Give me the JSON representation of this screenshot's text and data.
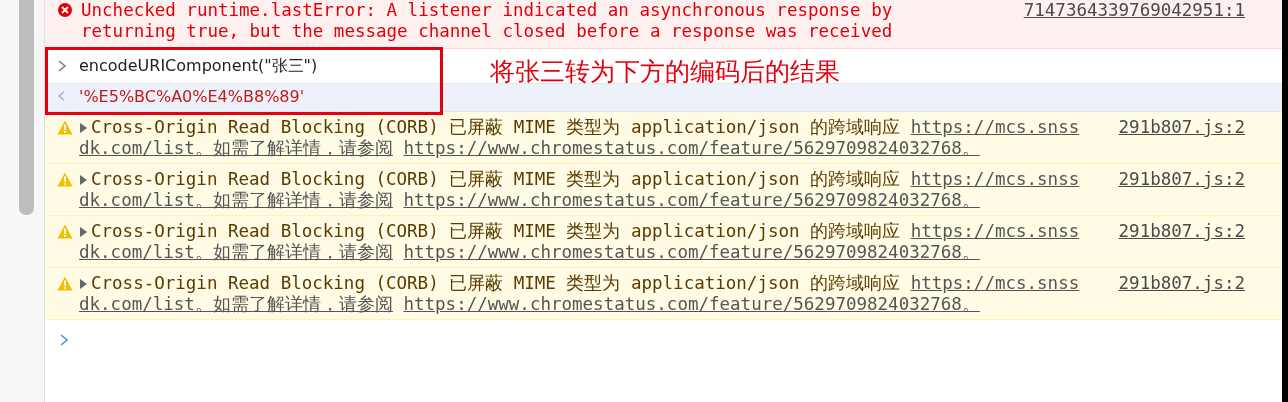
{
  "error": {
    "text_1": "Unchecked runtime.lastError: A listener indicated an asynchronous response by",
    "text_2": "returning true, but the message channel closed before a response was received",
    "source": "7147364339769042951:1"
  },
  "input": {
    "code": "encodeURIComponent(\"张三\")"
  },
  "output": {
    "value": "'%E5%BC%A0%E4%B8%89'"
  },
  "annotation": {
    "text": "将张三转为下方的编码后的结果"
  },
  "warnings": [
    {
      "expanded": false,
      "text": "Cross-Origin Read Blocking (CORB) 已屏蔽 MIME 类型为 application/json 的跨域响应",
      "link": "https://mcs.snss",
      "continuation": "dk.com/list。如需了解详情，请参阅",
      "doc_link": "https://www.chromestatus.com/feature/5629709824032768。",
      "source": "291b807.js:2"
    },
    {
      "expanded": false,
      "text": "Cross-Origin Read Blocking (CORB) 已屏蔽 MIME 类型为 application/json 的跨域响应",
      "link": "https://mcs.snss",
      "continuation": "dk.com/list。如需了解详情，请参阅",
      "doc_link": "https://www.chromestatus.com/feature/5629709824032768。",
      "source": "291b807.js:2"
    },
    {
      "expanded": false,
      "text": "Cross-Origin Read Blocking (CORB) 已屏蔽 MIME 类型为 application/json 的跨域响应",
      "link": "https://mcs.snss",
      "continuation": "dk.com/list。如需了解详情，请参阅",
      "doc_link": "https://www.chromestatus.com/feature/5629709824032768。",
      "source": "291b807.js:2"
    },
    {
      "expanded": false,
      "text": "Cross-Origin Read Blocking (CORB) 已屏蔽 MIME 类型为 application/json 的跨域响应",
      "link": "https://mcs.snss",
      "continuation": "dk.com/list。如需了解详情，请参阅",
      "doc_link": "https://www.chromestatus.com/feature/5629709824032768。",
      "source": "291b807.js:2"
    }
  ]
}
